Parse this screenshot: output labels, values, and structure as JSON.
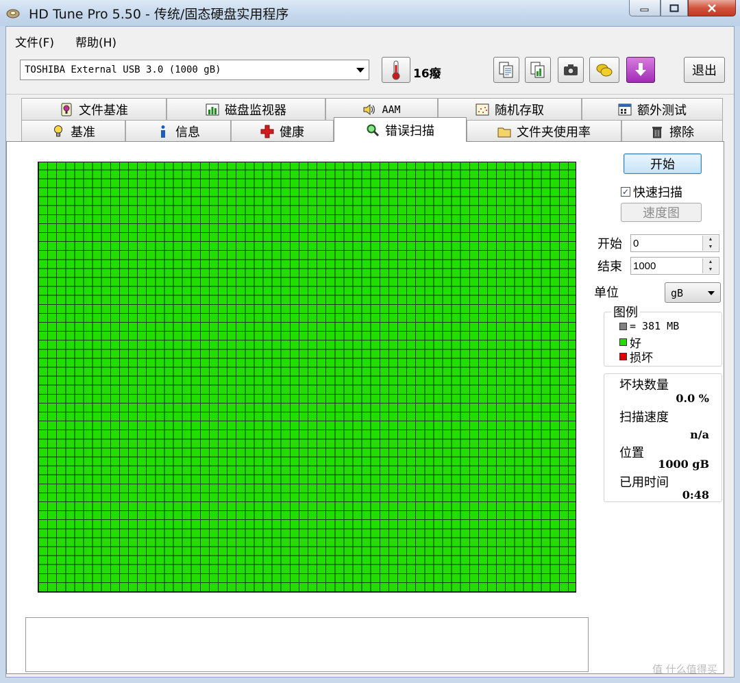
{
  "window": {
    "title": "HD Tune Pro 5.50 - 传统/固态硬盘实用程序"
  },
  "menu": {
    "file": "文件(F)",
    "help": "帮助(H)"
  },
  "toolbar": {
    "drive": "TOSHIBA External USB 3.0 (1000 gB)",
    "temperature": "16癈",
    "exit_label": "退出"
  },
  "tabs_row1": [
    {
      "label": "文件基准",
      "icon": "file-benchmark-icon"
    },
    {
      "label": "磁盘监视器",
      "icon": "disk-monitor-icon"
    },
    {
      "label": "AAM",
      "icon": "speaker-icon"
    },
    {
      "label": "随机存取",
      "icon": "random-access-icon"
    },
    {
      "label": "额外测试",
      "icon": "extra-tests-icon"
    }
  ],
  "tabs_row2": [
    {
      "label": "基准",
      "icon": "lightbulb-icon"
    },
    {
      "label": "信息",
      "icon": "info-icon"
    },
    {
      "label": "健康",
      "icon": "health-cross-icon"
    },
    {
      "label": "错误扫描",
      "icon": "magnifier-icon",
      "active": true
    },
    {
      "label": "文件夹使用率",
      "icon": "folder-icon"
    },
    {
      "label": "擦除",
      "icon": "trash-icon"
    }
  ],
  "scan": {
    "start_label": "开始",
    "quick_scan_label": "快速扫描",
    "quick_scan_checked": true,
    "speed_map_label": "速度图",
    "start_field_label": "开始",
    "start_value": "0",
    "end_field_label": "结束",
    "end_value": "1000",
    "unit_label": "单位",
    "unit_value": "gB"
  },
  "legend": {
    "title": "图例",
    "block_size": "= 381 MB",
    "good": "好",
    "bad": "损坏",
    "colors": {
      "block": "#808080",
      "good": "#22dd00",
      "bad": "#dd0000"
    }
  },
  "stats": {
    "bad_blocks_label": "坏块数量",
    "bad_blocks_value": "0.0 %",
    "scan_speed_label": "扫描速度",
    "scan_speed_value": "n/a",
    "position_label": "位置",
    "position_value": "1000 gB",
    "elapsed_label": "已用时间",
    "elapsed_value": "0:48"
  },
  "watermark": "值 什么值得买"
}
